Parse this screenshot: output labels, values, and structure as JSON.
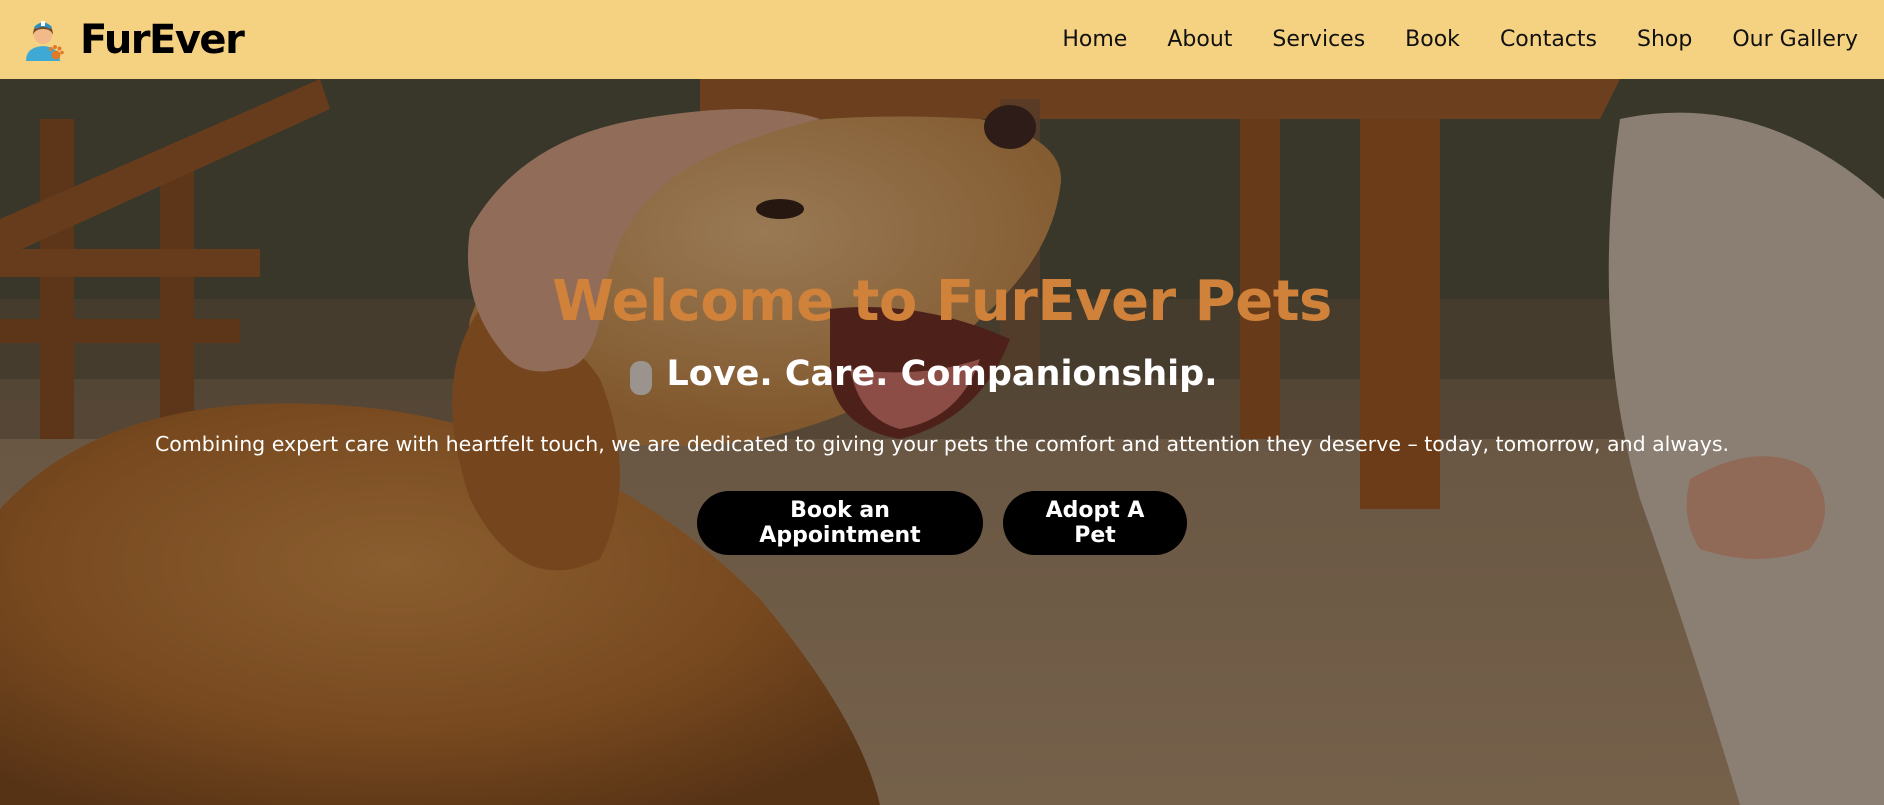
{
  "brand": {
    "name": "FurEver",
    "logo_icon": "vet-with-paw-icon"
  },
  "nav": {
    "items": [
      {
        "label": "Home"
      },
      {
        "label": "About"
      },
      {
        "label": "Services"
      },
      {
        "label": "Book"
      },
      {
        "label": "Contacts"
      },
      {
        "label": "Shop"
      },
      {
        "label": "Our Gallery"
      }
    ]
  },
  "hero": {
    "title": "Welcome to FurEver Pets",
    "subtitle": "Love. Care. Companionship.",
    "description": "Combining expert care with heartfelt touch, we are dedicated to giving your pets the comfort and attention they deserve – today, tomorrow, and always.",
    "buttons": {
      "book": "Book an Appointment",
      "adopt": "Adopt A Pet"
    },
    "background": "golden-retriever-being-petted-photo"
  },
  "colors": {
    "header_bg": "#f5d282",
    "title_accent": "#d0813a",
    "button_bg": "#000000",
    "button_text": "#ffffff"
  }
}
